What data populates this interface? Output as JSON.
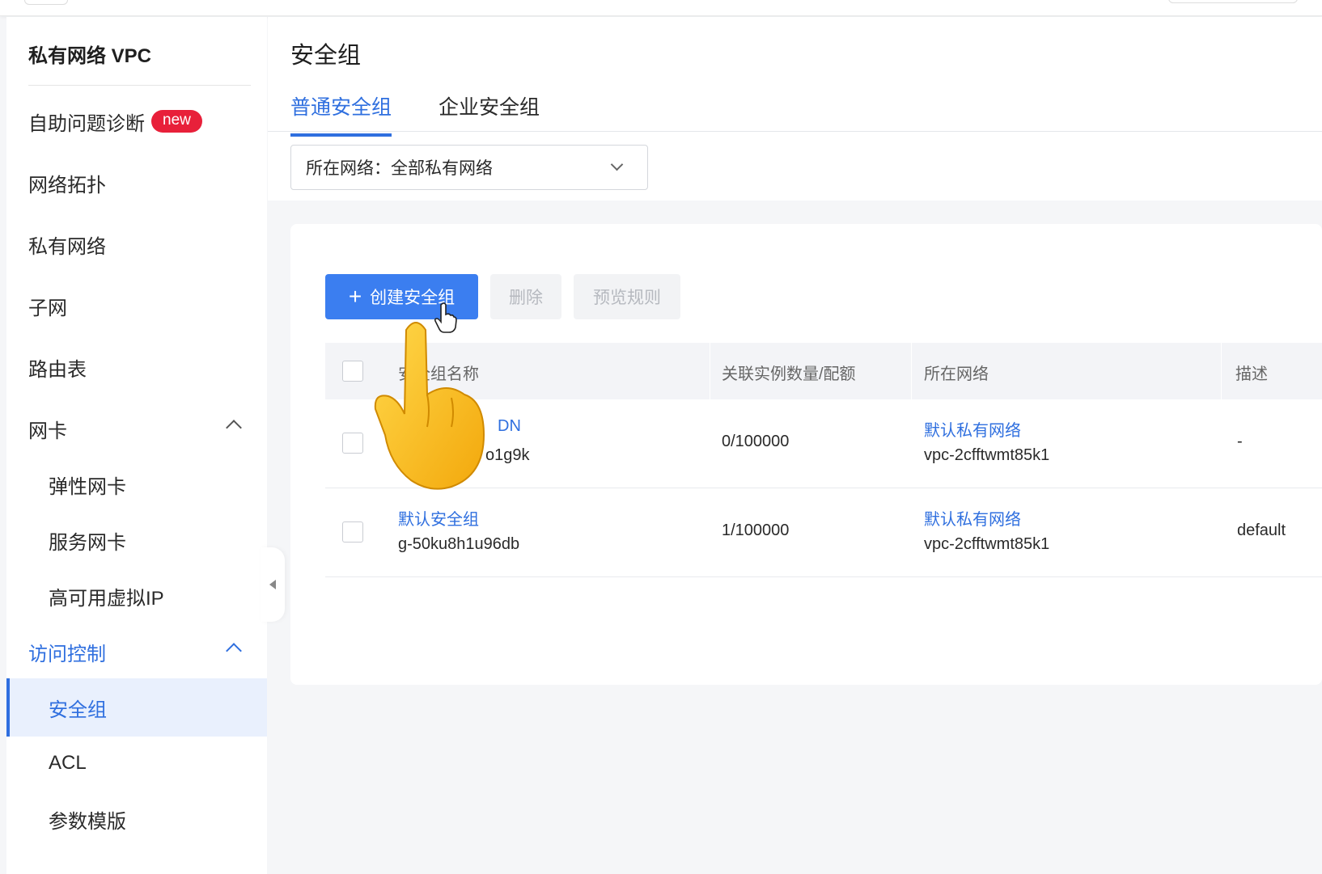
{
  "sidebar": {
    "title": "私有网络 VPC",
    "items": [
      {
        "label": "自助问题诊断",
        "badge": "new"
      },
      {
        "label": "网络拓扑"
      },
      {
        "label": "私有网络"
      },
      {
        "label": "子网"
      },
      {
        "label": "路由表"
      },
      {
        "label": "网卡",
        "expanded": true
      },
      {
        "label": "弹性网卡"
      },
      {
        "label": "服务网卡"
      },
      {
        "label": "高可用虚拟IP"
      },
      {
        "label": "访问控制",
        "expanded": true
      },
      {
        "label": "安全组",
        "selected": true
      },
      {
        "label": "ACL"
      },
      {
        "label": "参数模版"
      }
    ]
  },
  "header": {
    "title": "安全组",
    "tabs": [
      {
        "label": "普通安全组",
        "active": true
      },
      {
        "label": "企业安全组"
      }
    ],
    "network_select": "所在网络：全部私有网络"
  },
  "toolbar": {
    "create_label": "创建安全组",
    "delete_label": "删除",
    "preview_label": "预览规则"
  },
  "table": {
    "columns": [
      "安全组名称",
      "关联实例数量/配额",
      "所在网络",
      "描述"
    ],
    "rows": [
      {
        "name": "DN",
        "id_prefix": "g-",
        "id_suffix": "o1g9k",
        "count": "0/100000",
        "network": "默认私有网络",
        "vpc_id": "vpc-2cfftwmt85k1",
        "desc": "-"
      },
      {
        "name": "默认安全组",
        "id": "g-50ku8h1u96db",
        "count": "1/100000",
        "network": "默认私有网络",
        "vpc_id": "vpc-2cfftwmt85k1",
        "desc": "default"
      }
    ]
  },
  "colors": {
    "accent": "#2f6fdf",
    "primary_button": "#3b7ef0",
    "badge": "#e8203a",
    "selected_bg": "#e9f0fd"
  }
}
